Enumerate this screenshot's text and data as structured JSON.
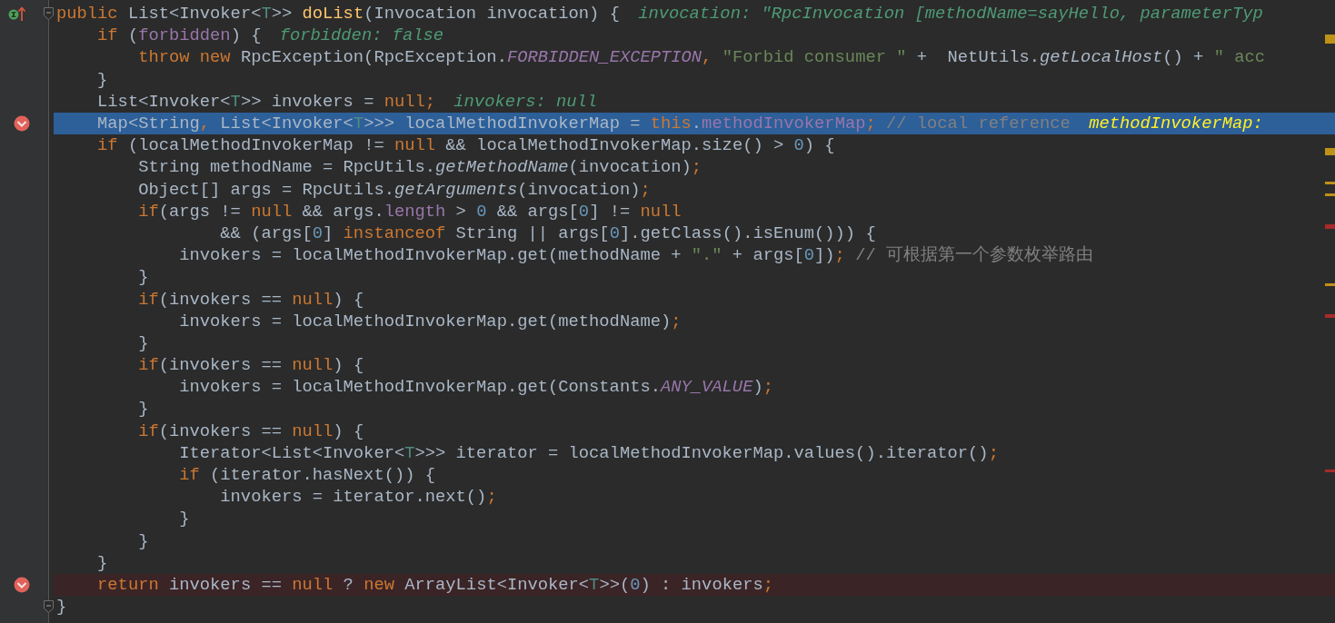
{
  "editor": {
    "lines": [
      {
        "kind": "plain",
        "gutter": {
          "kind": "override"
        },
        "fold": true,
        "tokens": [
          {
            "kind": "kw",
            "text": "public "
          },
          {
            "kind": "p",
            "text": "List<Invoker<"
          },
          {
            "kind": "tp",
            "text": "T"
          },
          {
            "kind": "p",
            "text": ">> "
          },
          {
            "kind": "fn",
            "text": "doList"
          },
          {
            "kind": "p",
            "text": "(Invocation invocation) {"
          }
        ],
        "hint": {
          "kind": "value",
          "text": "invocation: \"RpcInvocation [methodName=sayHello, parameterTyp"
        }
      },
      {
        "kind": "plain",
        "tokens": [
          {
            "kind": "kw",
            "text": "    if "
          },
          {
            "kind": "p",
            "text": "("
          },
          {
            "kind": "f",
            "text": "forbidden"
          },
          {
            "kind": "p",
            "text": ") {"
          }
        ],
        "hint": {
          "kind": "value",
          "text": "forbidden: false"
        }
      },
      {
        "kind": "plain",
        "tokens": [
          {
            "kind": "kw",
            "text": "        throw new "
          },
          {
            "kind": "p",
            "text": "RpcException(RpcException."
          },
          {
            "kind": "sf",
            "text": "FORBIDDEN_EXCEPTION"
          },
          {
            "kind": "kw",
            "text": ", "
          },
          {
            "kind": "s",
            "text": "\"Forbid consumer \""
          },
          {
            "kind": "p",
            "text": " +  NetUtils."
          },
          {
            "kind": "sm",
            "text": "getLocalHost"
          },
          {
            "kind": "p",
            "text": "() + "
          },
          {
            "kind": "s",
            "text": "\" acc"
          }
        ]
      },
      {
        "kind": "plain",
        "tokens": [
          {
            "kind": "p",
            "text": "    }"
          }
        ]
      },
      {
        "kind": "plain",
        "tokens": [
          {
            "kind": "p",
            "text": "    List<Invoker<"
          },
          {
            "kind": "tp",
            "text": "T"
          },
          {
            "kind": "p",
            "text": ">> invokers = "
          },
          {
            "kind": "kw",
            "text": "null;"
          }
        ],
        "hint": {
          "kind": "value",
          "text": "invokers: null"
        }
      },
      {
        "kind": "execution",
        "gutter": {
          "kind": "breakpoint"
        },
        "tokens": [
          {
            "kind": "p",
            "text": "    Map<String"
          },
          {
            "kind": "kw",
            "text": ", "
          },
          {
            "kind": "p",
            "text": "List<Invoker<"
          },
          {
            "kind": "tp",
            "text": "T"
          },
          {
            "kind": "p",
            "text": ">>> localMethodInvokerMap = "
          },
          {
            "kind": "kw",
            "text": "this"
          },
          {
            "kind": "p",
            "text": "."
          },
          {
            "kind": "f",
            "text": "methodInvokerMap"
          },
          {
            "kind": "kw",
            "text": "; "
          },
          {
            "kind": "c",
            "text": "// local reference"
          }
        ],
        "hint": {
          "kind": "changed",
          "text": "methodInvokerMap:"
        }
      },
      {
        "kind": "plain",
        "tokens": [
          {
            "kind": "kw",
            "text": "    if "
          },
          {
            "kind": "p",
            "text": "(localMethodInvokerMap != "
          },
          {
            "kind": "kw",
            "text": "null "
          },
          {
            "kind": "p",
            "text": "&& localMethodInvokerMap.size() > "
          },
          {
            "kind": "n",
            "text": "0"
          },
          {
            "kind": "p",
            "text": ") {"
          }
        ]
      },
      {
        "kind": "plain",
        "tokens": [
          {
            "kind": "p",
            "text": "        String methodName = RpcUtils."
          },
          {
            "kind": "sm",
            "text": "getMethodName"
          },
          {
            "kind": "p",
            "text": "(invocation)"
          },
          {
            "kind": "kw",
            "text": ";"
          }
        ]
      },
      {
        "kind": "plain",
        "tokens": [
          {
            "kind": "p",
            "text": "        Object[] args = RpcUtils."
          },
          {
            "kind": "sm",
            "text": "getArguments"
          },
          {
            "kind": "p",
            "text": "(invocation)"
          },
          {
            "kind": "kw",
            "text": ";"
          }
        ]
      },
      {
        "kind": "plain",
        "tokens": [
          {
            "kind": "kw",
            "text": "        if"
          },
          {
            "kind": "p",
            "text": "(args != "
          },
          {
            "kind": "kw",
            "text": "null "
          },
          {
            "kind": "p",
            "text": "&& args."
          },
          {
            "kind": "f",
            "text": "length"
          },
          {
            "kind": "p",
            "text": " > "
          },
          {
            "kind": "n",
            "text": "0"
          },
          {
            "kind": "p",
            "text": " && args["
          },
          {
            "kind": "n",
            "text": "0"
          },
          {
            "kind": "p",
            "text": "] != "
          },
          {
            "kind": "kw",
            "text": "null"
          }
        ]
      },
      {
        "kind": "plain",
        "tokens": [
          {
            "kind": "p",
            "text": "                && (args["
          },
          {
            "kind": "n",
            "text": "0"
          },
          {
            "kind": "p",
            "text": "] "
          },
          {
            "kind": "kw",
            "text": "instanceof "
          },
          {
            "kind": "p",
            "text": "String || args["
          },
          {
            "kind": "n",
            "text": "0"
          },
          {
            "kind": "p",
            "text": "].getClass().isEnum())) {"
          }
        ]
      },
      {
        "kind": "plain",
        "tokens": [
          {
            "kind": "p",
            "text": "            invokers = localMethodInvokerMap.get(methodName + "
          },
          {
            "kind": "s",
            "text": "\".\""
          },
          {
            "kind": "p",
            "text": " + args["
          },
          {
            "kind": "n",
            "text": "0"
          },
          {
            "kind": "p",
            "text": "])"
          },
          {
            "kind": "kw",
            "text": "; "
          },
          {
            "kind": "c",
            "text": "// 可根据第一个参数枚举路由"
          }
        ]
      },
      {
        "kind": "plain",
        "tokens": [
          {
            "kind": "p",
            "text": "        }"
          }
        ]
      },
      {
        "kind": "plain",
        "tokens": [
          {
            "kind": "kw",
            "text": "        if"
          },
          {
            "kind": "p",
            "text": "(invokers == "
          },
          {
            "kind": "kw",
            "text": "null"
          },
          {
            "kind": "p",
            "text": ") {"
          }
        ]
      },
      {
        "kind": "plain",
        "tokens": [
          {
            "kind": "p",
            "text": "            invokers = localMethodInvokerMap.get(methodName)"
          },
          {
            "kind": "kw",
            "text": ";"
          }
        ]
      },
      {
        "kind": "plain",
        "tokens": [
          {
            "kind": "p",
            "text": "        }"
          }
        ]
      },
      {
        "kind": "plain",
        "tokens": [
          {
            "kind": "kw",
            "text": "        if"
          },
          {
            "kind": "p",
            "text": "(invokers == "
          },
          {
            "kind": "kw",
            "text": "null"
          },
          {
            "kind": "p",
            "text": ") {"
          }
        ]
      },
      {
        "kind": "plain",
        "tokens": [
          {
            "kind": "p",
            "text": "            invokers = localMethodInvokerMap.get(Constants."
          },
          {
            "kind": "sf",
            "text": "ANY_VALUE"
          },
          {
            "kind": "p",
            "text": ")"
          },
          {
            "kind": "kw",
            "text": ";"
          }
        ]
      },
      {
        "kind": "plain",
        "tokens": [
          {
            "kind": "p",
            "text": "        }"
          }
        ]
      },
      {
        "kind": "plain",
        "tokens": [
          {
            "kind": "kw",
            "text": "        if"
          },
          {
            "kind": "p",
            "text": "(invokers == "
          },
          {
            "kind": "kw",
            "text": "null"
          },
          {
            "kind": "p",
            "text": ") {"
          }
        ]
      },
      {
        "kind": "plain",
        "tokens": [
          {
            "kind": "p",
            "text": "            Iterator<List<Invoker<"
          },
          {
            "kind": "tp",
            "text": "T"
          },
          {
            "kind": "p",
            "text": ">>> iterator = localMethodInvokerMap.values().iterator()"
          },
          {
            "kind": "kw",
            "text": ";"
          }
        ]
      },
      {
        "kind": "plain",
        "tokens": [
          {
            "kind": "kw",
            "text": "            if "
          },
          {
            "kind": "p",
            "text": "(iterator.hasNext()) {"
          }
        ]
      },
      {
        "kind": "plain",
        "tokens": [
          {
            "kind": "p",
            "text": "                invokers = iterator.next()"
          },
          {
            "kind": "kw",
            "text": ";"
          }
        ]
      },
      {
        "kind": "plain",
        "tokens": [
          {
            "kind": "p",
            "text": "            }"
          }
        ]
      },
      {
        "kind": "plain",
        "tokens": [
          {
            "kind": "p",
            "text": "        }"
          }
        ]
      },
      {
        "kind": "plain",
        "tokens": [
          {
            "kind": "p",
            "text": "    }"
          }
        ]
      },
      {
        "kind": "breakpoint",
        "gutter": {
          "kind": "breakpoint"
        },
        "tokens": [
          {
            "kind": "kw",
            "text": "    return "
          },
          {
            "kind": "p",
            "text": "invokers == "
          },
          {
            "kind": "kw",
            "text": "null "
          },
          {
            "kind": "p",
            "text": "? "
          },
          {
            "kind": "kw",
            "text": "new "
          },
          {
            "kind": "p",
            "text": "ArrayList<Invoker<"
          },
          {
            "kind": "tp",
            "text": "T"
          },
          {
            "kind": "p",
            "text": ">>("
          },
          {
            "kind": "n",
            "text": "0"
          },
          {
            "kind": "p",
            "text": ") : invokers"
          },
          {
            "kind": "kw",
            "text": ";"
          }
        ]
      },
      {
        "kind": "plain",
        "fold": true,
        "tokens": [
          {
            "kind": "p",
            "text": "}"
          }
        ]
      }
    ]
  }
}
